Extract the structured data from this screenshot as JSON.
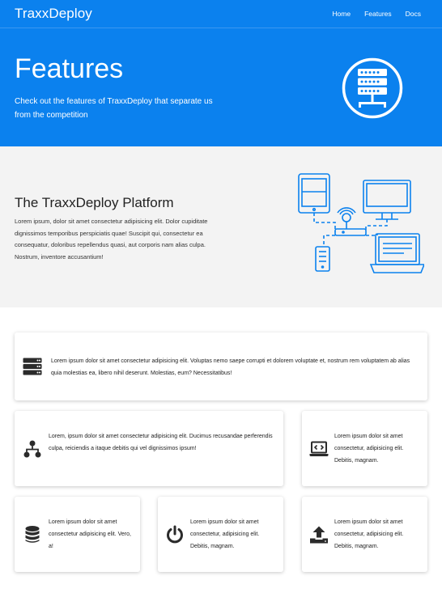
{
  "navbar": {
    "brand": "TraxxDeploy",
    "links": [
      {
        "label": "Home"
      },
      {
        "label": "Features"
      },
      {
        "label": "Docs"
      }
    ]
  },
  "hero": {
    "title": "Features",
    "subtitle": "Check out the features of TraxxDeploy that separate us from the competition",
    "icon": "server-circle-icon"
  },
  "platform": {
    "title": "The TraxxDeploy Platform",
    "text": "Lorem ipsum, dolor sit amet consectetur adipisicing elit. Dolor cupiditate dignissimos temporibus perspiciatis quae! Suscipit qui, consectetur ea consequatur, doloribus repellendus quasi, aut corporis nam alias culpa. Nostrum, inventore accusantium!",
    "diagram_icon": "network-devices-icon"
  },
  "colors": {
    "primary": "#0b81ee",
    "section_bg": "#f3f3f3",
    "icon_dark": "#2b2b2b"
  },
  "cards": [
    {
      "icon": "server-icon",
      "text": "Lorem ipsum dolor sit amet consectetur adipisicing elit. Voluptas nemo saepe corrupti et dolorem voluptate et, nostrum rem voluptatem ab alias quia molestias ea, libero nihil deserunt. Molestias, eum? Necessitatibus!"
    },
    {
      "icon": "sitemap-icon",
      "text": "Lorem, ipsum dolor sit amet consectetur adipisicing elit. Ducimus recusandae perferendis culpa, reiciendis a itaque debitis qui vel dignissimos ipsum!"
    },
    {
      "icon": "laptop-code-icon",
      "text": "Lorem ipsum dolor sit amet consectetur, adipisicing elit. Debitis, magnam."
    },
    {
      "icon": "database-icon",
      "text": "Lorem ipsum dolor sit amet consectetur adipisicing elit. Vero, a!"
    },
    {
      "icon": "power-icon",
      "text": "Lorem ipsum dolor sit amet consectetur, adipisicing elit. Debitis, magnam."
    },
    {
      "icon": "upload-icon",
      "text": "Lorem ipsum dolor sit amet consectetur, adipisicing elit. Debitis, magnam."
    }
  ]
}
